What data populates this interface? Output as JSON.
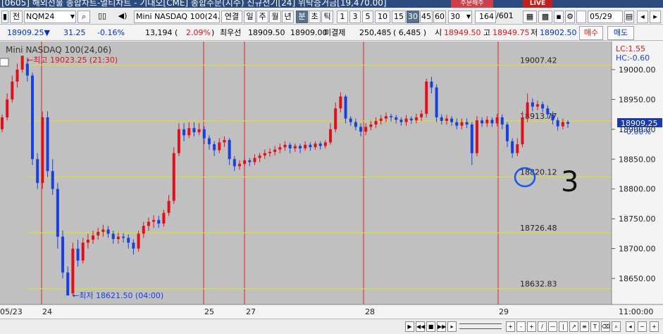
{
  "window": {
    "title": "[0605] 해외선물 종합차트-멀티차트 - 기대오[CME] 종합주문(지수) 신규전기[24] 위탁증거금[19,470.00]",
    "order_button": "주문해주",
    "live_badge": "LIVE"
  },
  "toolbar": {
    "jeon_label": "전",
    "symbol": "NQM24",
    "product_name": "Mini NASDAQ 100(24.06)",
    "link_label": "연결",
    "periods": [
      "일",
      "주",
      "월",
      "년",
      "분",
      "초",
      "틱"
    ],
    "selected_period": "분",
    "intervals": [
      "1",
      "3",
      "5",
      "10",
      "15",
      "30",
      "45",
      "60"
    ],
    "selected_interval": "30",
    "interval_select": "30",
    "count_value": "164",
    "count_total": "/601",
    "date_value": "05/29"
  },
  "quote": {
    "price": "18909.25▼",
    "change": "31.25",
    "change_pct": "-0.16%",
    "volume": "13,194",
    "volume_pct_open": "(",
    "volume_pct": "2.09%",
    "volume_pct_close": ")",
    "best_bid_label": "최우선",
    "best_bid": "18909.50",
    "best_ask": "18909.00",
    "open_interest_label": "미결제",
    "open_interest": "250,485",
    "oi_change": "( 6,485 )",
    "open_label": "시",
    "open": "18949.50",
    "high_label": "고",
    "high": "18949.75",
    "low_label": "저",
    "low": "18902.50",
    "buy_button": "매수",
    "sell_button": "매도"
  },
  "chart": {
    "title": "Mini NASDAQ 100(24,06)",
    "lc_label": "LC:1.55",
    "hc_label": "HC:-0.60",
    "high_annotation": "←최고 19023.25 (21:30)",
    "low_annotation": "←최저 18621.50 (04:00)",
    "hline_labels": [
      "19007.42",
      "18913.77",
      "18820.12",
      "18726.48",
      "18632.83"
    ],
    "current_price_tag": "18909.25",
    "current_pct_tag": "-0.00%",
    "handwritten_mark": "3",
    "date_labels": [
      "05/23",
      "24",
      "25",
      "27",
      "28",
      "29"
    ],
    "time_label": "11:00:00",
    "y_ticks": [
      "19000.00",
      "18950.00",
      "18900.00",
      "18850.00",
      "18800.00",
      "18750.00",
      "18700.00",
      "18650.00"
    ],
    "up_color": "#e0101a",
    "down_color": "#1840e0",
    "hline_color": "#e8e020",
    "bg_color": "#c0c0c0"
  },
  "chart_data": {
    "type": "candlestick",
    "title": "Mini NASDAQ 100(24,06)",
    "ylim": [
      18610,
      19040
    ],
    "x_labels": [
      "05/23",
      "24",
      "25",
      "27",
      "28",
      "29"
    ],
    "candles": [
      [
        18900,
        18920,
        18895,
        18925
      ],
      [
        18920,
        18950,
        18915,
        18960
      ],
      [
        18950,
        18980,
        18945,
        18990
      ],
      [
        18980,
        19000,
        18970,
        19010
      ],
      [
        19000,
        19023.25,
        18995,
        19023.25
      ],
      [
        19010,
        18990,
        18980,
        19020
      ],
      [
        18990,
        18850,
        18840,
        18995
      ],
      [
        18850,
        18810,
        18800,
        18860
      ],
      [
        18810,
        18920,
        18800,
        18930
      ],
      [
        18920,
        18830,
        18820,
        18930
      ],
      [
        18830,
        18800,
        18790,
        18850
      ],
      [
        18800,
        18720,
        18700,
        18810
      ],
      [
        18720,
        18660,
        18650,
        18730
      ],
      [
        18660,
        18621.5,
        18621.5,
        18670
      ],
      [
        18625,
        18700,
        18620,
        18710
      ],
      [
        18700,
        18680,
        18670,
        18715
      ],
      [
        18680,
        18710,
        18675,
        18718
      ],
      [
        18710,
        18715,
        18700,
        18725
      ],
      [
        18715,
        18722,
        18708,
        18730
      ],
      [
        18722,
        18728,
        18715,
        18735
      ],
      [
        18728,
        18732,
        18720,
        18740
      ],
      [
        18732,
        18725,
        18718,
        18738
      ],
      [
        18725,
        18716,
        18708,
        18730
      ],
      [
        18716,
        18720,
        18708,
        18727
      ],
      [
        18720,
        18718,
        18710,
        18726
      ],
      [
        18718,
        18710,
        18700,
        18724
      ],
      [
        18710,
        18700,
        18690,
        18716
      ],
      [
        18700,
        18725,
        18695,
        18730
      ],
      [
        18725,
        18738,
        18718,
        18745
      ],
      [
        18738,
        18745,
        18730,
        18752
      ],
      [
        18745,
        18748,
        18735,
        18756
      ],
      [
        18748,
        18742,
        18735,
        18755
      ],
      [
        18742,
        18760,
        18737,
        18765
      ],
      [
        18760,
        18780,
        18755,
        18790
      ],
      [
        18780,
        18860,
        18775,
        18870
      ],
      [
        18860,
        18900,
        18855,
        18910
      ],
      [
        18900,
        18890,
        18880,
        18910
      ],
      [
        18890,
        18902,
        18885,
        18912
      ],
      [
        18902,
        18895,
        18888,
        18912
      ],
      [
        18895,
        18900,
        18890,
        18910
      ],
      [
        18900,
        18885,
        18875,
        18905
      ],
      [
        18885,
        18875,
        18866,
        18890
      ],
      [
        18875,
        18865,
        18855,
        18880
      ],
      [
        18865,
        18878,
        18860,
        18885
      ],
      [
        18878,
        18882,
        18870,
        18888
      ],
      [
        18882,
        18850,
        18840,
        18885
      ],
      [
        18850,
        18838,
        18830,
        18855
      ],
      [
        18838,
        18842,
        18832,
        18848
      ],
      [
        18842,
        18848,
        18838,
        18854
      ],
      [
        18848,
        18845,
        18838,
        18852
      ],
      [
        18845,
        18852,
        18840,
        18858
      ],
      [
        18852,
        18856,
        18845,
        18860
      ],
      [
        18856,
        18860,
        18850,
        18866
      ],
      [
        18860,
        18862,
        18854,
        18868
      ],
      [
        18862,
        18866,
        18856,
        18872
      ],
      [
        18866,
        18870,
        18860,
        18876
      ],
      [
        18870,
        18874,
        18864,
        18880
      ],
      [
        18874,
        18868,
        18860,
        18878
      ],
      [
        18868,
        18872,
        18862,
        18876
      ],
      [
        18872,
        18868,
        18860,
        18876
      ],
      [
        18868,
        18874,
        18864,
        18880
      ],
      [
        18874,
        18870,
        18864,
        18878
      ],
      [
        18870,
        18876,
        18866,
        18880
      ],
      [
        18876,
        18872,
        18866,
        18880
      ],
      [
        18872,
        18878,
        18868,
        18882
      ],
      [
        18878,
        18900,
        18874,
        18910
      ],
      [
        18900,
        18935,
        18895,
        18945
      ],
      [
        18935,
        18955,
        18928,
        18962
      ],
      [
        18955,
        18918,
        18910,
        18958
      ],
      [
        18918,
        18912,
        18906,
        18922
      ],
      [
        18912,
        18904,
        18898,
        18918
      ],
      [
        18904,
        18896,
        18888,
        18910
      ],
      [
        18896,
        18904,
        18890,
        18910
      ],
      [
        18904,
        18908,
        18898,
        18914
      ],
      [
        18908,
        18914,
        18902,
        18920
      ],
      [
        18914,
        18918,
        18908,
        18924
      ],
      [
        18918,
        18922,
        18912,
        18928
      ],
      [
        18922,
        18920,
        18913,
        18926
      ],
      [
        18920,
        18916,
        18910,
        18924
      ],
      [
        18916,
        18912,
        18906,
        18920
      ],
      [
        18912,
        18918,
        18906,
        18924
      ],
      [
        18918,
        18915,
        18909,
        18922
      ],
      [
        18915,
        18920,
        18910,
        18926
      ],
      [
        18920,
        18926,
        18914,
        18932
      ],
      [
        18926,
        18980,
        18920,
        18985
      ],
      [
        18980,
        18970,
        18960,
        18988
      ],
      [
        18970,
        18920,
        18912,
        18975
      ],
      [
        18920,
        18914,
        18908,
        18925
      ],
      [
        18914,
        18918,
        18908,
        18924
      ],
      [
        18918,
        18912,
        18906,
        18922
      ],
      [
        18912,
        18906,
        18900,
        18918
      ],
      [
        18906,
        18912,
        18900,
        18918
      ],
      [
        18912,
        18908,
        18902,
        18918
      ],
      [
        18908,
        18860,
        18840,
        18912
      ],
      [
        18860,
        18915,
        18855,
        18922
      ],
      [
        18915,
        18910,
        18904,
        18920
      ],
      [
        18910,
        18916,
        18904,
        18922
      ],
      [
        18916,
        18910,
        18904,
        18920
      ],
      [
        18910,
        18920,
        18905,
        18926
      ],
      [
        18920,
        18908,
        18900,
        18925
      ],
      [
        18908,
        18880,
        18870,
        18912
      ],
      [
        18880,
        18860,
        18852,
        18885
      ],
      [
        18860,
        18875,
        18855,
        18885
      ],
      [
        18875,
        18920,
        18870,
        18930
      ],
      [
        18920,
        18945,
        18912,
        18960
      ],
      [
        18945,
        18938,
        18930,
        18952
      ],
      [
        18938,
        18942,
        18932,
        18948
      ],
      [
        18942,
        18935,
        18928,
        18946
      ],
      [
        18935,
        18925,
        18918,
        18940
      ],
      [
        18925,
        18915,
        18908,
        18930
      ],
      [
        18915,
        18905,
        18898,
        18920
      ],
      [
        18905,
        18912,
        18900,
        18918
      ],
      [
        18912,
        18909.25,
        18902.5,
        18915
      ]
    ]
  }
}
